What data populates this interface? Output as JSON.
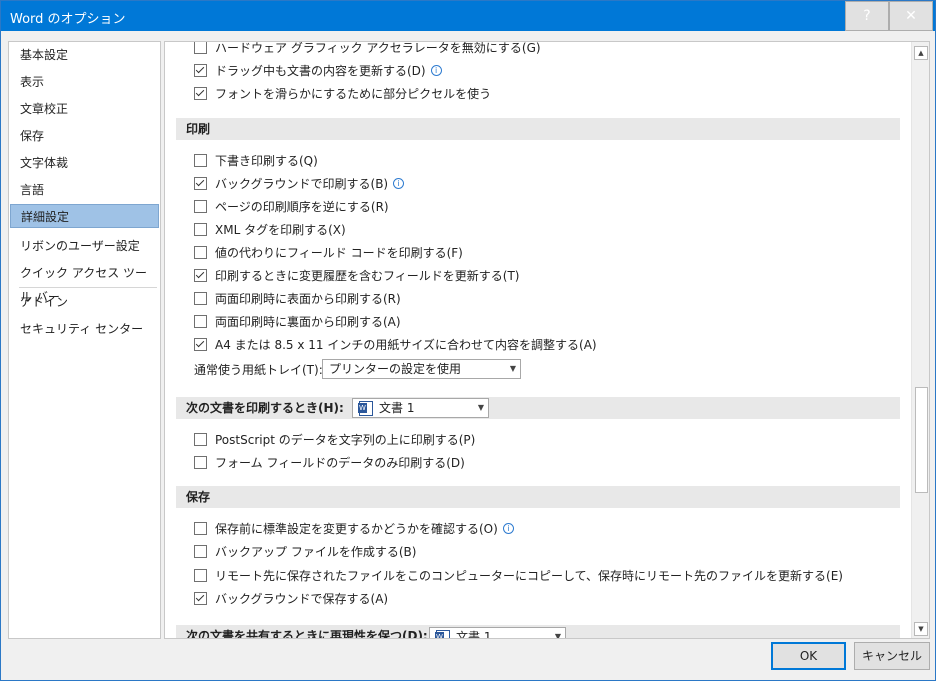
{
  "window": {
    "title": "Word のオプション",
    "help_label": "?",
    "close_label": "✕"
  },
  "nav": {
    "items": [
      "基本設定",
      "表示",
      "文章校正",
      "保存",
      "文字体裁",
      "言語",
      "詳細設定",
      "リボンのユーザー設定",
      "クイック アクセス ツール バー",
      "アドイン",
      "セキュリティ センター"
    ],
    "selected": "詳細設定"
  },
  "options_top": [
    {
      "label": "ハードウェア グラフィック アクセラレータを無効にする(G)",
      "checked": false
    },
    {
      "label": "ドラッグ中も文書の内容を更新する(D)",
      "checked": true,
      "info": true
    },
    {
      "label": "フォントを滑らかにするために部分ピクセルを使う",
      "checked": true
    }
  ],
  "print_section": {
    "title": "印刷",
    "options": [
      {
        "label": "下書き印刷する(Q)",
        "checked": false
      },
      {
        "label": "バックグラウンドで印刷する(B)",
        "checked": true,
        "info": true
      },
      {
        "label": "ページの印刷順序を逆にする(R)",
        "checked": false
      },
      {
        "label": "XML タグを印刷する(X)",
        "checked": false
      },
      {
        "label": "値の代わりにフィールド コードを印刷する(F)",
        "checked": false
      },
      {
        "label": "印刷するときに変更履歴を含むフィールドを更新する(T)",
        "checked": true
      },
      {
        "label": "両面印刷時に表面から印刷する(R)",
        "checked": false
      },
      {
        "label": "両面印刷時に裏面から印刷する(A)",
        "checked": false
      },
      {
        "label": "A4 または 8.5 x 11 インチの用紙サイズに合わせて内容を調整する(A)",
        "checked": true
      }
    ],
    "tray_label": "通常使う用紙トレイ(T):",
    "tray_value": "プリンターの設定を使用"
  },
  "doc_print_section": {
    "title": "次の文書を印刷するとき(H):",
    "doc_value": "文書 1",
    "options": [
      {
        "label": "PostScript のデータを文字列の上に印刷する(P)",
        "checked": false
      },
      {
        "label": "フォーム フィールドのデータのみ印刷する(D)",
        "checked": false
      }
    ]
  },
  "save_section": {
    "title": "保存",
    "options": [
      {
        "label": "保存前に標準設定を変更するかどうかを確認する(O)",
        "checked": false,
        "info": true
      },
      {
        "label": "バックアップ ファイルを作成する(B)",
        "checked": false
      },
      {
        "label": "リモート先に保存されたファイルをこのコンピューターにコピーして、保存時にリモート先のファイルを更新する(E)",
        "checked": false
      },
      {
        "label": "バックグラウンドで保存する(A)",
        "checked": true
      }
    ]
  },
  "share_section": {
    "title": "次の文書を共有するときに再現性を保つ(D):",
    "doc_value": "文書 1"
  },
  "buttons": {
    "ok": "OK",
    "cancel": "キャンセル"
  },
  "colors": {
    "titlebar": "#0078d7",
    "selected_nav": "#9fc2e6",
    "info_icon": "#2e7bd0"
  }
}
